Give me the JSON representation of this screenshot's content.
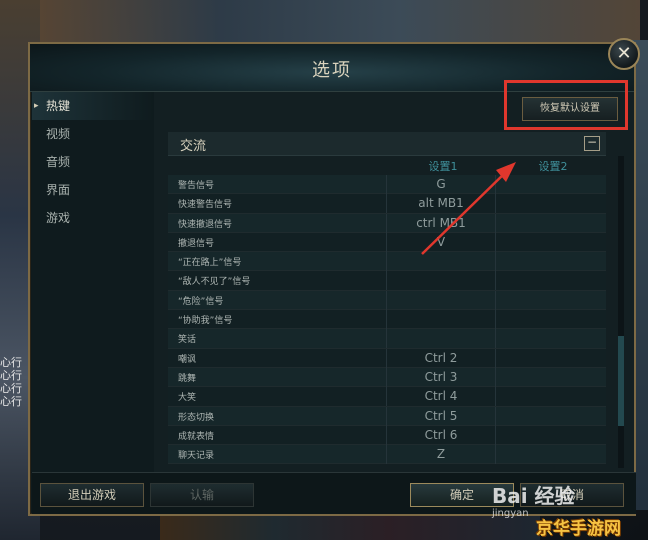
{
  "window": {
    "title": "选项",
    "close_glyph": "✕"
  },
  "nav": {
    "items": [
      {
        "label": "热键",
        "active": true
      },
      {
        "label": "视频",
        "active": false
      },
      {
        "label": "音频",
        "active": false
      },
      {
        "label": "界面",
        "active": false
      },
      {
        "label": "游戏",
        "active": false
      }
    ],
    "active_marker": "▸"
  },
  "toolbar": {
    "restore_label": "恢复默认设置"
  },
  "section": {
    "title": "交流",
    "collapse_glyph": "−"
  },
  "table": {
    "headers": [
      "设置1",
      "设置2"
    ],
    "rows": [
      {
        "label": "警告信号",
        "s1": "G",
        "s2": ""
      },
      {
        "label": "快速警告信号",
        "s1": "alt  MB1",
        "s2": ""
      },
      {
        "label": "快速撤退信号",
        "s1": "ctrl  MB1",
        "s2": ""
      },
      {
        "label": "撤退信号",
        "s1": "V",
        "s2": ""
      },
      {
        "label": "“正在路上”信号",
        "s1": "",
        "s2": ""
      },
      {
        "label": "“敌人不见了”信号",
        "s1": "",
        "s2": ""
      },
      {
        "label": "“危险”信号",
        "s1": "",
        "s2": ""
      },
      {
        "label": "“协助我”信号",
        "s1": "",
        "s2": ""
      },
      {
        "label": "笑话",
        "s1": "",
        "s2": ""
      },
      {
        "label": "嘲讽",
        "s1": "Ctrl  2",
        "s2": ""
      },
      {
        "label": "跳舞",
        "s1": "Ctrl  3",
        "s2": ""
      },
      {
        "label": "大笑",
        "s1": "Ctrl  4",
        "s2": ""
      },
      {
        "label": "形态切换",
        "s1": "Ctrl  5",
        "s2": ""
      },
      {
        "label": "成就表情",
        "s1": "Ctrl  6",
        "s2": ""
      },
      {
        "label": "聊天记录",
        "s1": "Z",
        "s2": ""
      }
    ]
  },
  "bottom": {
    "exit_label": "退出游戏",
    "surrender_label": "认输",
    "ok_label": "确定",
    "cancel_label": "取消"
  },
  "side_chat": [
    "心行",
    "心行",
    "心行",
    "心行"
  ],
  "watermark": {
    "baidu": "Bai 经验",
    "baidu_sub": "jingyan",
    "site": "京华手游网"
  },
  "colors": {
    "highlight_red": "#e0372d",
    "accent_gold": "#9c8a5c",
    "header_teal": "#3f8f9a"
  }
}
